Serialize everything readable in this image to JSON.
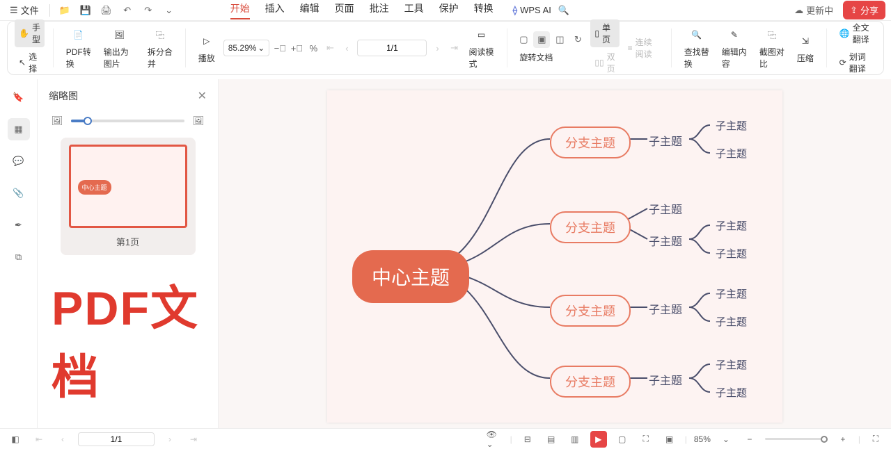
{
  "topbar": {
    "file": "文件",
    "wps_ai": "WPS AI",
    "update": "更新中",
    "share": "分享"
  },
  "tabs": [
    "开始",
    "插入",
    "编辑",
    "页面",
    "批注",
    "工具",
    "保护",
    "转换"
  ],
  "active_tab": 0,
  "ribbon": {
    "hand": "手型",
    "select": "选择",
    "pdf_convert": "PDF转换",
    "export_img": "输出为图片",
    "split_merge": "拆分合并",
    "play": "播放",
    "zoom": "85.29%",
    "page": "1/1",
    "rotate": "旋转文档",
    "single": "单页",
    "double": "双页",
    "continuous": "连续阅读",
    "read_mode": "阅读模式",
    "find_replace": "查找替换",
    "edit_content": "编辑内容",
    "compare": "截图对比",
    "compress": "压缩",
    "full_trans": "全文翻译",
    "sel_trans": "划词翻译"
  },
  "thumb": {
    "title": "缩略图",
    "page_label": "第1页"
  },
  "watermark": "PDF文档",
  "mindmap": {
    "center": "中心主题",
    "branch": "分支主题",
    "sub": "子主题"
  },
  "status": {
    "page": "1/1",
    "zoom": "85%"
  }
}
